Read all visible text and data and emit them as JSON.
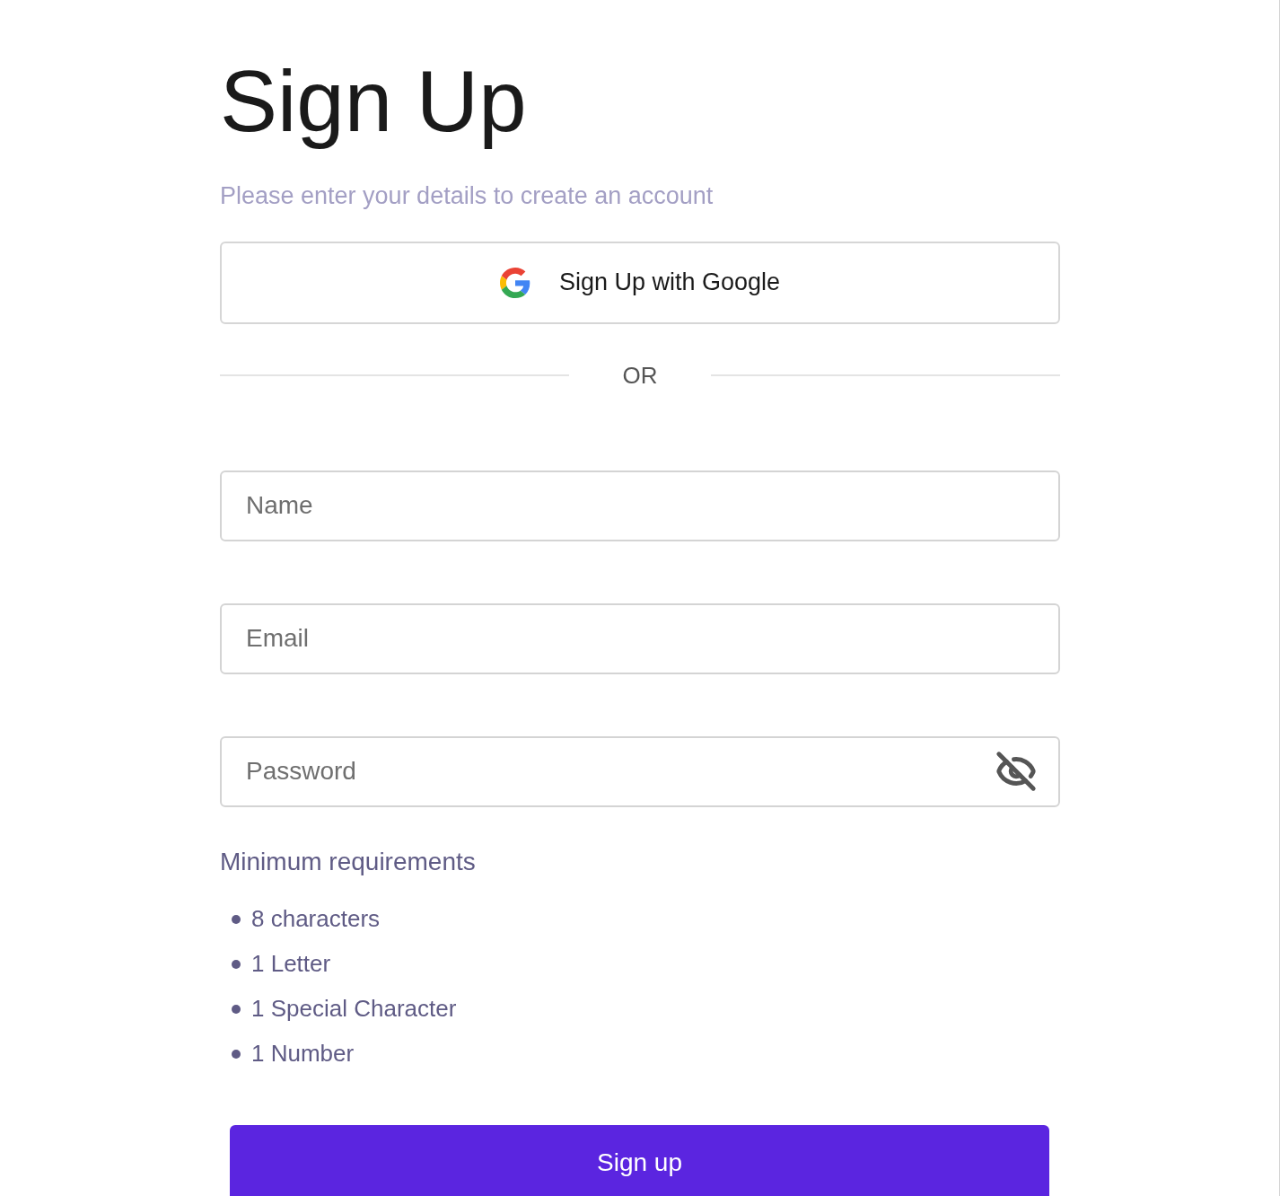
{
  "title": "Sign Up",
  "subtitle": "Please enter your details to create an account",
  "google_button": {
    "label": "Sign Up with Google"
  },
  "divider": {
    "label": "OR"
  },
  "fields": [
    {
      "placeholder": "Name",
      "kind": "text"
    },
    {
      "placeholder": "Email",
      "kind": "text"
    },
    {
      "placeholder": "Password",
      "kind": "password"
    }
  ],
  "requirements": {
    "heading": "Minimum requirements",
    "items": [
      "8 characters",
      "1 Letter",
      "1 Special Character",
      "1 Number"
    ]
  },
  "submit_button": {
    "label": "Sign up"
  }
}
